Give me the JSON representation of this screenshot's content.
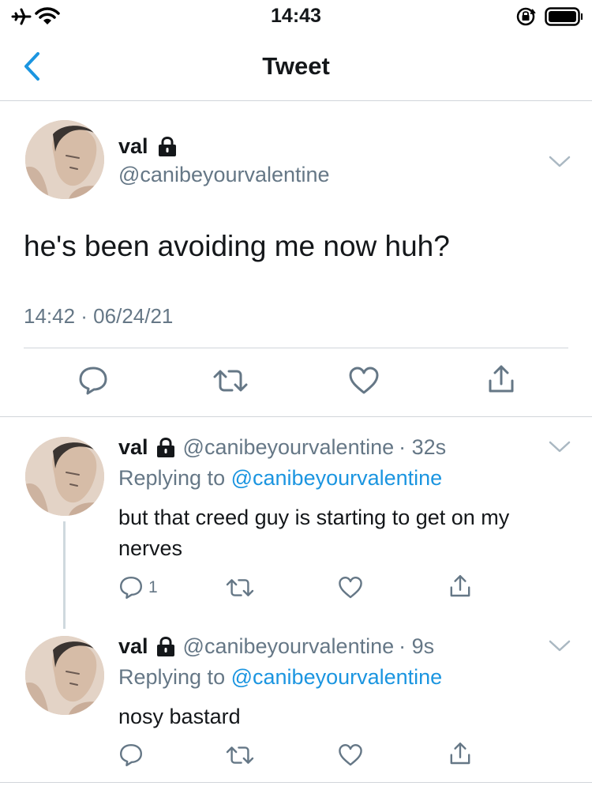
{
  "status_bar": {
    "time": "14:43"
  },
  "nav": {
    "title": "Tweet"
  },
  "main_tweet": {
    "display_name": "val",
    "handle": "@canibeyourvalentine",
    "text": "he's been avoiding me now huh?",
    "timestamp": "14:42 · 06/24/21"
  },
  "replies": [
    {
      "display_name": "val",
      "handle": "@canibeyourvalentine",
      "time": "· 32s",
      "replying_prefix": "Replying to",
      "replying_to": "@canibeyourvalentine",
      "text": "but that creed guy is starting to get on my nerves",
      "reply_count": "1"
    },
    {
      "display_name": "val",
      "handle": "@canibeyourvalentine",
      "time": "· 9s",
      "replying_prefix": "Replying to",
      "replying_to": "@canibeyourvalentine",
      "text": "nosy bastard"
    }
  ],
  "colors": {
    "accent": "#1b95e0",
    "secondary": "#657786",
    "divider": "#d1d5da"
  },
  "icons": [
    "airplane-icon",
    "wifi-icon",
    "rotation-lock-icon",
    "battery-icon",
    "back-chevron-icon",
    "lock-icon",
    "chevron-down-icon",
    "reply-icon",
    "retweet-icon",
    "like-icon",
    "share-icon"
  ]
}
